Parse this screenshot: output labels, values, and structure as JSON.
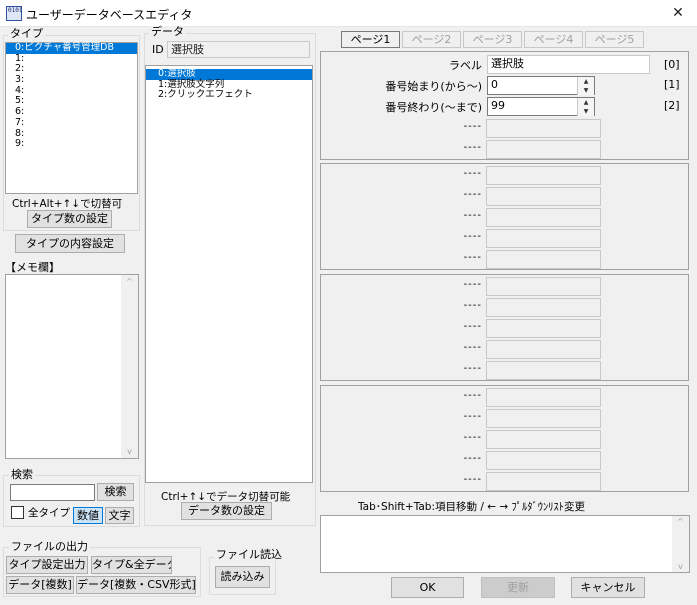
{
  "window": {
    "title": "ユーザーデータベースエディタ",
    "icon_text": "0101",
    "close_glyph": "✕"
  },
  "type_group": {
    "title": "タイプ",
    "items": [
      "0:ピクチャ番号管理DB",
      "1:",
      "2:",
      "3:",
      "4:",
      "5:",
      "6:",
      "7:",
      "8:",
      "9:"
    ],
    "selected_index": 0,
    "hint": "Ctrl+Alt+↑↓で切替可",
    "count_button": "タイプ数の設定"
  },
  "type_content_button": "タイプの内容設定",
  "memo": {
    "title": "【メモ欄】",
    "value": ""
  },
  "search": {
    "title": "検索",
    "input_value": "",
    "button": "検索",
    "all_types_label": "全タイプ",
    "all_types_checked": false,
    "mode_number": "数値",
    "mode_text": "文字"
  },
  "file_output": {
    "title": "ファイルの出力",
    "buttons": [
      "タイプ設定出力",
      "タイプ&全データ",
      "データ[複数]",
      "データ[複数・CSV形式]"
    ]
  },
  "file_input": {
    "title": "ファイル読込",
    "button": "読み込み"
  },
  "data_group": {
    "title": "データ",
    "id_label": "ID",
    "id_value": "選択肢",
    "items": [
      "0:選択肢",
      "1:選択肢文字列",
      "2:クリックエフェクト"
    ],
    "selected_index": 0,
    "hint": "Ctrl+↑↓でデータ切替可能",
    "count_button": "データ数の設定"
  },
  "tabs": [
    "ページ1",
    "ページ2",
    "ページ3",
    "ページ4",
    "ページ5"
  ],
  "active_tab": 0,
  "fields": [
    {
      "label": "ラベル",
      "value": "選択肢",
      "index": "[0]"
    },
    {
      "label": "番号始まり(から～)",
      "value": "0",
      "index": "[1]"
    },
    {
      "label": "番号終わり(～まで)",
      "value": "99",
      "index": "[2]"
    }
  ],
  "dash_label": "----",
  "footer_hint": "Tab･Shift+Tab:項目移動 / ← → ﾌﾟﾙﾀﾞｳﾝﾘｽﾄ変更",
  "description": "",
  "buttons": {
    "ok": "OK",
    "update": "更新",
    "cancel": "キャンセル"
  }
}
